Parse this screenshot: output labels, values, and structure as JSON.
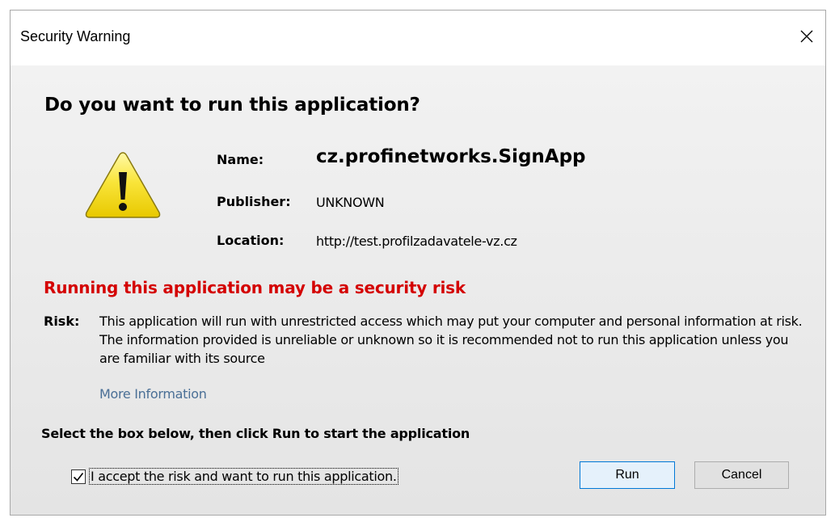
{
  "window": {
    "title": "Security Warning",
    "close_icon": "close-icon"
  },
  "prompt": {
    "question": "Do you want to run this application?"
  },
  "details": {
    "name_label": "Name:",
    "name_value": "cz.profinetworks.SignApp",
    "publisher_label": "Publisher:",
    "publisher_value": "UNKNOWN",
    "location_label": "Location:",
    "location_value": "http://test.profilzadavatele-vz.cz"
  },
  "risk": {
    "headline": "Running this application may be a security risk",
    "label": "Risk:",
    "text": "This application will run with unrestricted access which may put your computer and personal information at risk. The information provided is unreliable or unknown so it is recommended not to run this application unless you are familiar with its source",
    "more_info_link": "More Information"
  },
  "confirm": {
    "instruction": "Select the box below, then click Run to start the application",
    "checkbox_label": "I accept the risk and want to run this application.",
    "checkbox_checked": true
  },
  "buttons": {
    "run_label": "Run",
    "cancel_label": "Cancel"
  },
  "colors": {
    "risk_red": "#d40000",
    "link_blue": "#4a6f96",
    "default_button_border": "#0078d7",
    "warning_yellow": "#f7e01a"
  },
  "icons": {
    "warning": "warning-triangle-icon",
    "check": "checkmark-icon"
  }
}
